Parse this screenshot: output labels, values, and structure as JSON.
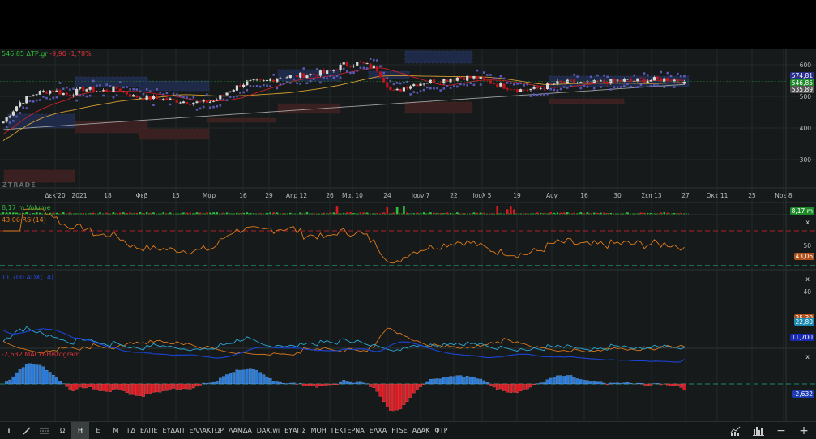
{
  "header": {
    "price": "546,85",
    "symbol": "ΔΤΡ.gr",
    "change": "-9,90",
    "change_pct": "-1,78%"
  },
  "watermark": "ZTRADE",
  "xaxis": [
    "Δεκ'20",
    "2021",
    "18",
    "Φεβ",
    "15",
    "Μαρ",
    "16",
    "29",
    "Απρ 12",
    "26",
    "Μαι 10",
    "24",
    "Ιουν 7",
    "22",
    "Ιουλ 5",
    "19",
    "Αυγ",
    "16",
    "30",
    "Σεπ 13",
    "27",
    "Οκτ 11",
    "25",
    "Νοε 8"
  ],
  "price_axis": [
    "600",
    "500",
    "400",
    "300"
  ],
  "price_badges": [
    {
      "text": "574,81",
      "color": "#2a2f8a"
    },
    {
      "text": "546,85",
      "color": "#1f8a2a"
    },
    {
      "text": "535,89",
      "color": "#555"
    }
  ],
  "volume": {
    "label": "8,17 m Volume",
    "badge": "8,17 m"
  },
  "rsi": {
    "label": "43,06 RSI(14)",
    "axis": "50",
    "badge": "43,06"
  },
  "adx": {
    "label": "11,700 ADX(14)",
    "axis": "40",
    "badges": [
      "25,30",
      "22,80",
      "11,700"
    ]
  },
  "macd": {
    "label": "-2,632 MACD-Histogram",
    "badge": "-2,632"
  },
  "close_label": "x",
  "toolbar": {
    "left_icons": [
      "info-icon",
      "draw-line-icon",
      "layers-icon"
    ],
    "periods": [
      "Ω",
      "Η",
      "Ε",
      "Μ"
    ],
    "active_period": "Η",
    "symbols": [
      "ΓΔ",
      "ΕΛΠΕ",
      "ΕΥΔΑΠ",
      "ΕΛΛΑΚΤΩΡ",
      "ΛΑΜΔΑ",
      "DAX.wi",
      "ΕΥΑΠΣ",
      "ΜΟΗ",
      "ΓΕΚΤΕΡΝΑ",
      "ΕΛΧΑ",
      "FTSE",
      "ΑΔΑΚ",
      "ΦΤΡ"
    ],
    "right_icons": [
      "chart-type-icon",
      "indicators-icon",
      "zoom-out-icon",
      "zoom-in-icon"
    ]
  },
  "colors": {
    "up": "#d8d8d8",
    "down": "#c0141c",
    "rsi": "#e07a1a",
    "adx": "#1a44d8",
    "di_plus": "#29a8d8",
    "di_minus": "#d8781a",
    "macd_up": "#2a7ad8",
    "macd_down": "#d81a22",
    "ma_fast": "#c8202a",
    "ma_slow": "#d8a030",
    "ma_long": "#a0a0a0",
    "sar": "#5a5ab8"
  },
  "chart_data": {
    "type": "candlestick",
    "title": "ΔΤΡ.gr",
    "weekly_close": [
      420,
      480,
      510,
      520,
      505,
      525,
      515,
      525,
      500,
      495,
      490,
      485,
      480,
      485,
      520,
      545,
      545,
      560,
      565,
      570,
      575,
      600,
      605,
      590,
      510,
      535,
      545,
      550,
      560,
      560,
      545,
      530,
      520,
      525,
      540,
      545,
      540,
      545,
      550,
      550,
      552,
      555,
      547
    ],
    "ylim": [
      250,
      640
    ]
  }
}
